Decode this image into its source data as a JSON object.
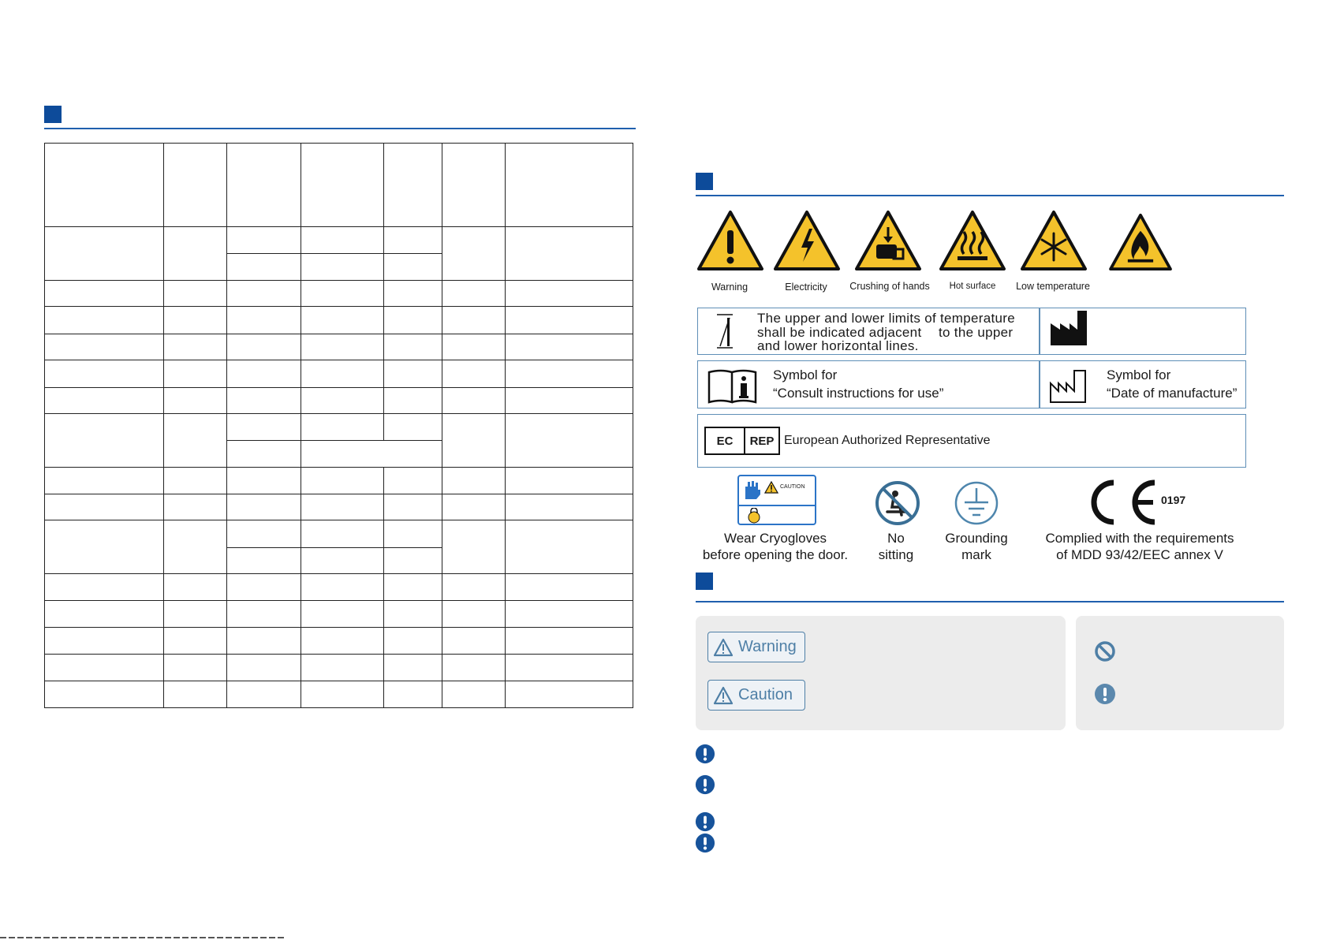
{
  "hazard_labels": [
    "Warning",
    "Electricity",
    "Crushing of hands",
    "Hot surface",
    "Low temperature"
  ],
  "temp_box": {
    "line1": "The upper and lower limits of temperature",
    "line2a": "shall be indicated adjacent",
    "line2b": "to the upper",
    "line3": "and lower horizontal lines."
  },
  "consult_box": {
    "line1": "Symbol for",
    "line2": "“Consult instructions for use”"
  },
  "date_box": {
    "line1": "Symbol for",
    "line2": "“Date of manufacture”"
  },
  "ec_box": {
    "ec": "EC",
    "rep": "REP",
    "text": "European Authorized Representative"
  },
  "cryo": {
    "caution": "CAUTION",
    "line1": "Wear Cryogloves",
    "line2": "before opening the door."
  },
  "no_sitting": {
    "line1": "No",
    "line2": "sitting"
  },
  "grounding": {
    "line1": "Grounding",
    "line2": "mark"
  },
  "ce": {
    "number": "0197",
    "line1": "Complied with the requirements",
    "line2": "of MDD 93/42/EEC annex V"
  },
  "notice": {
    "warning": "Warning",
    "caution": "Caution"
  },
  "colors": {
    "accent": "#0d4b9a",
    "hazard_yellow": "#f4c22b",
    "frame_blue": "#5f8fb7"
  }
}
